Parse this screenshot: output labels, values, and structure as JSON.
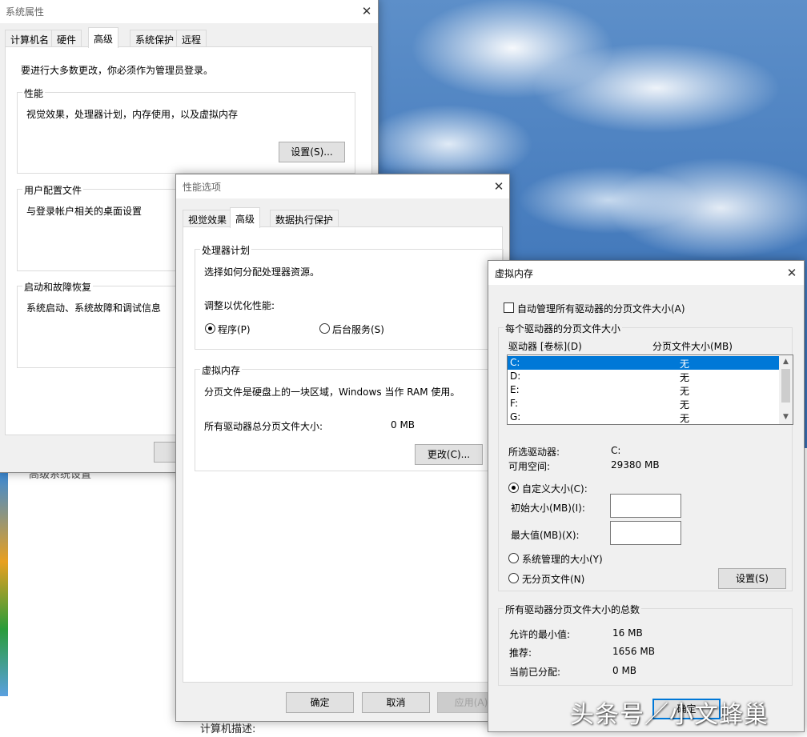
{
  "system_properties": {
    "title": "系统属性",
    "tabs": [
      "计算机名",
      "硬件",
      "高级",
      "系统保护",
      "远程"
    ],
    "admin_note": "要进行大多数更改，你必须作为管理员登录。",
    "performance": {
      "title": "性能",
      "desc": "视觉效果，处理器计划，内存使用，以及虚拟内存",
      "button": "设置(S)..."
    },
    "user_profiles": {
      "title": "用户配置文件",
      "desc": "与登录帐户相关的桌面设置"
    },
    "startup_recovery": {
      "title": "启动和故障恢复",
      "desc": "系统启动、系统故障和调试信息"
    }
  },
  "background": {
    "link": "高级系统设置",
    "computer_desc": "计算机描述:"
  },
  "performance_options": {
    "title": "性能选项",
    "tabs": [
      "视觉效果",
      "高级",
      "数据执行保护"
    ],
    "processor": {
      "title": "处理器计划",
      "desc": "选择如何分配处理器资源。",
      "adjust_label": "调整以优化性能:",
      "option_programs": "程序(P)",
      "option_services": "后台服务(S)"
    },
    "virtual_memory": {
      "title": "虚拟内存",
      "desc": "分页文件是硬盘上的一块区域，Windows 当作 RAM 使用。",
      "total_label": "所有驱动器总分页文件大小:",
      "total_value": "0 MB",
      "change_button": "更改(C)..."
    },
    "buttons": {
      "ok": "确定",
      "cancel": "取消",
      "apply": "应用(A)"
    }
  },
  "virtual_memory_dialog": {
    "title": "虚拟内存",
    "auto_manage": "自动管理所有驱动器的分页文件大小(A)",
    "per_drive_group": "每个驱动器的分页文件大小",
    "col_drive": "驱动器 [卷标](D)",
    "col_size": "分页文件大小(MB)",
    "drives": [
      {
        "drive": "C:",
        "size": "无"
      },
      {
        "drive": "D:",
        "size": "无"
      },
      {
        "drive": "E:",
        "size": "无"
      },
      {
        "drive": "F:",
        "size": "无"
      },
      {
        "drive": "G:",
        "size": "无"
      }
    ],
    "selected_drive_label": "所选驱动器:",
    "selected_drive_value": "C:",
    "free_space_label": "可用空间:",
    "free_space_value": "29380 MB",
    "custom_size": "自定义大小(C):",
    "initial_size_label": "初始大小(MB)(I):",
    "initial_size_value": "",
    "max_size_label": "最大值(MB)(X):",
    "max_size_value": "",
    "system_managed": "系统管理的大小(Y)",
    "no_paging": "无分页文件(N)",
    "set_button": "设置(S)",
    "totals_group": "所有驱动器分页文件大小的总数",
    "min_allowed_label": "允许的最小值:",
    "min_allowed_value": "16 MB",
    "recommended_label": "推荐:",
    "recommended_value": "1656 MB",
    "allocated_label": "当前已分配:",
    "allocated_value": "0 MB",
    "ok_button": "确定"
  },
  "watermark": "头条号／小文蜂巢"
}
